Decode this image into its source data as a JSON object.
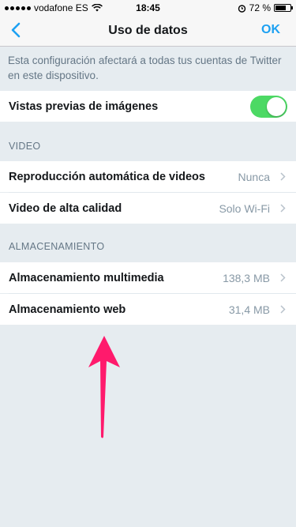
{
  "status_bar": {
    "carrier": "vodafone ES",
    "time": "18:45",
    "battery": "72 %",
    "battery_level": 0.72
  },
  "nav": {
    "title": "Uso de datos",
    "ok_label": "OK"
  },
  "info_text": "Esta configuración afectará a todas tus cuentas de Twitter en este dispositivo.",
  "image_previews": {
    "label": "Vistas previas de imágenes",
    "enabled": true
  },
  "video_section": {
    "header": "VIDEO",
    "items": [
      {
        "label": "Reproducción automática de videos",
        "value": "Nunca"
      },
      {
        "label": "Video de alta calidad",
        "value": "Solo Wi-Fi"
      }
    ]
  },
  "storage_section": {
    "header": "ALMACENAMIENTO",
    "items": [
      {
        "label": "Almacenamiento multimedia",
        "value": "138,3 MB"
      },
      {
        "label": "Almacenamiento web",
        "value": "31,4 MB"
      }
    ]
  },
  "colors": {
    "accent": "#1da1f2",
    "toggle_on": "#4cd964",
    "annotation_arrow": "#ff1a6c",
    "background": "#e6ecf0"
  }
}
